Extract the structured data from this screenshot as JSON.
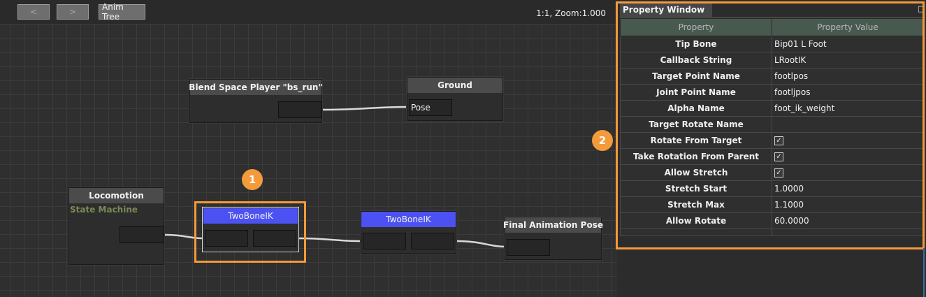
{
  "toolbar": {
    "back_label": "<",
    "forward_label": ">",
    "anim_tree_label": "Anim Tree",
    "zoom_text": "1:1, Zoom:1.000"
  },
  "nodes": {
    "blend_space": {
      "title": "Blend Space Player \"bs_run\""
    },
    "ground": {
      "title": "Ground",
      "pin_label": "Pose"
    },
    "locomotion": {
      "title": "Locomotion",
      "subtitle": "State Machine"
    },
    "twobone1": {
      "title": "TwoBoneIK"
    },
    "twobone2": {
      "title": "TwoBoneIK"
    },
    "final_pose": {
      "title": "Final Animation Pose"
    }
  },
  "callouts": {
    "one": "1",
    "two": "2"
  },
  "property_window": {
    "title": "Property Window",
    "dock_icon": "pin-icon",
    "columns": {
      "property": "Property",
      "value": "Property Value"
    },
    "rows": [
      {
        "name": "Tip Bone",
        "value": "Bip01 L Foot"
      },
      {
        "name": "Callback String",
        "value": "LRootIK"
      },
      {
        "name": "Target Point Name",
        "value": "footlpos"
      },
      {
        "name": "Joint Point Name",
        "value": "footljpos"
      },
      {
        "name": "Alpha Name",
        "value": "foot_ik_weight"
      },
      {
        "name": "Target Rotate Name",
        "value": ""
      },
      {
        "name": "Rotate From Target",
        "checked": true
      },
      {
        "name": "Take Rotation From Parent",
        "checked": true
      },
      {
        "name": "Allow Stretch",
        "checked": true
      },
      {
        "name": "Stretch Start",
        "value": "1.0000"
      },
      {
        "name": "Stretch Max",
        "value": "1.1000"
      },
      {
        "name": "Allow Rotate",
        "value": "60.0000"
      }
    ]
  },
  "colors": {
    "accent_orange": "#f39a3b",
    "ik_node_header": "#4c52f2",
    "table_header": "#485a4f"
  }
}
